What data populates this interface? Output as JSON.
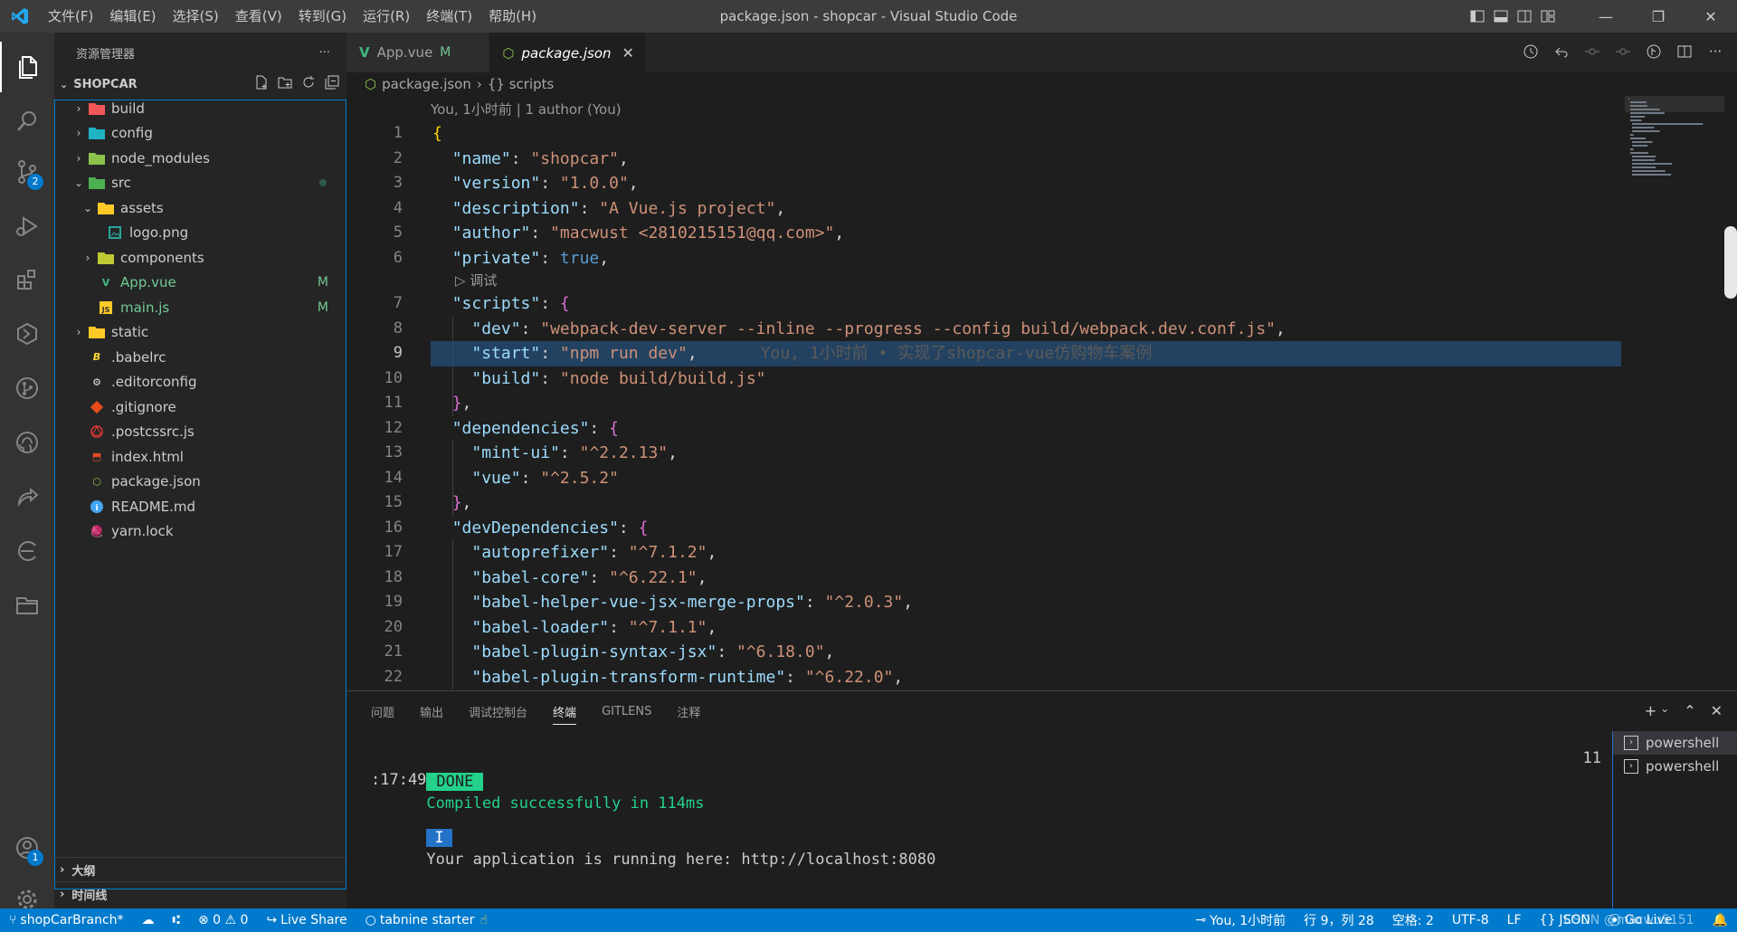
{
  "window": {
    "title": "package.json - shopcar - Visual Studio Code",
    "menu": [
      "文件(F)",
      "编辑(E)",
      "选择(S)",
      "查看(V)",
      "转到(G)",
      "运行(R)",
      "终端(T)",
      "帮助(H)"
    ]
  },
  "activity": {
    "scm_badge": "2",
    "accounts_badge": "1"
  },
  "sidebar": {
    "title": "资源管理器",
    "more": "···",
    "section": "SHOPCAR",
    "tree": [
      {
        "label": "build",
        "depth": 0,
        "chev": "›",
        "icon": "folder-build-icon",
        "color": "#f25757"
      },
      {
        "label": "config",
        "depth": 0,
        "chev": "›",
        "icon": "folder-config-icon",
        "color": "#20b3c4"
      },
      {
        "label": "node_modules",
        "depth": 0,
        "chev": "›",
        "icon": "folder-node-icon",
        "color": "#8bc34a"
      },
      {
        "label": "src",
        "depth": 0,
        "chev": "⌄",
        "icon": "folder-src-icon",
        "color": "#4caf50"
      },
      {
        "label": "assets",
        "depth": 1,
        "chev": "⌄",
        "icon": "folder-assets-icon",
        "color": "#ffca28"
      },
      {
        "label": "logo.png",
        "depth": 2,
        "chev": "",
        "icon": "image-file-icon",
        "color": "#26a69a"
      },
      {
        "label": "components",
        "depth": 1,
        "chev": "›",
        "icon": "folder-components-icon",
        "color": "#c0ca33"
      },
      {
        "label": "App.vue",
        "depth": 1,
        "chev": "",
        "icon": "vue-file-icon",
        "color": "#41b883",
        "git": "M"
      },
      {
        "label": "main.js",
        "depth": 1,
        "chev": "",
        "icon": "js-file-icon",
        "color": "#ffca28",
        "git": "M"
      },
      {
        "label": "static",
        "depth": 0,
        "chev": "›",
        "icon": "folder-static-icon",
        "color": "#ffca28"
      },
      {
        "label": ".babelrc",
        "depth": 0,
        "chev": "",
        "icon": "babel-file-icon",
        "color": "#fdd835"
      },
      {
        "label": ".editorconfig",
        "depth": 0,
        "chev": "",
        "icon": "editorconfig-file-icon",
        "color": "#e0e0e0"
      },
      {
        "label": ".gitignore",
        "depth": 0,
        "chev": "",
        "icon": "git-file-icon",
        "color": "#e64a19"
      },
      {
        "label": ".postcssrc.js",
        "depth": 0,
        "chev": "",
        "icon": "postcss-file-icon",
        "color": "#e53935"
      },
      {
        "label": "index.html",
        "depth": 0,
        "chev": "",
        "icon": "html-file-icon",
        "color": "#e44d26"
      },
      {
        "label": "package.json",
        "depth": 0,
        "chev": "",
        "icon": "nodejs-file-icon",
        "color": "#8bc34a"
      },
      {
        "label": "README.md",
        "depth": 0,
        "chev": "",
        "icon": "info-file-icon",
        "color": "#42a5f5"
      },
      {
        "label": "yarn.lock",
        "depth": 0,
        "chev": "",
        "icon": "yarn-file-icon",
        "color": "#2c8ebb"
      }
    ],
    "outline": "大纲",
    "timeline": "时间线"
  },
  "editor": {
    "tabs": [
      {
        "label": "App.vue",
        "badge": "M",
        "active": false
      },
      {
        "label": "package.json",
        "badge": "",
        "active": true
      }
    ],
    "breadcrumb": [
      "package.json",
      "{} scripts"
    ],
    "blame_header": "You, 1小时前 | 1 author (You)",
    "codelens": "▷ 调试",
    "inline_blame": "You, 1小时前 • 实现了shopcar-vue仿购物车案例",
    "lines": [
      {
        "n": "1",
        "t": "{"
      },
      {
        "n": "2",
        "t": "  \"name\": \"shopcar\","
      },
      {
        "n": "3",
        "t": "  \"version\": \"1.0.0\","
      },
      {
        "n": "4",
        "t": "  \"description\": \"A Vue.js project\","
      },
      {
        "n": "5",
        "t": "  \"author\": \"macwust <2810215151@qq.com>\","
      },
      {
        "n": "6",
        "t": "  \"private\": true,"
      },
      {
        "n": "7",
        "t": "  \"scripts\": {"
      },
      {
        "n": "8",
        "t": "    \"dev\": \"webpack-dev-server --inline --progress --config build/webpack.dev.conf.js\","
      },
      {
        "n": "9",
        "t": "    \"start\": \"npm run dev\","
      },
      {
        "n": "10",
        "t": "    \"build\": \"node build/build.js\""
      },
      {
        "n": "11",
        "t": "  },"
      },
      {
        "n": "12",
        "t": "  \"dependencies\": {"
      },
      {
        "n": "13",
        "t": "    \"mint-ui\": \"^2.2.13\","
      },
      {
        "n": "14",
        "t": "    \"vue\": \"^2.5.2\""
      },
      {
        "n": "15",
        "t": "  },"
      },
      {
        "n": "16",
        "t": "  \"devDependencies\": {"
      },
      {
        "n": "17",
        "t": "    \"autoprefixer\": \"^7.1.2\","
      },
      {
        "n": "18",
        "t": "    \"babel-core\": \"^6.22.1\","
      },
      {
        "n": "19",
        "t": "    \"babel-helper-vue-jsx-merge-props\": \"^2.0.3\","
      },
      {
        "n": "20",
        "t": "    \"babel-loader\": \"^7.1.1\","
      },
      {
        "n": "21",
        "t": "    \"babel-plugin-syntax-jsx\": \"^6.18.0\","
      },
      {
        "n": "22",
        "t": "    \"babel-plugin-transform-runtime\": \"^6.22.0\","
      }
    ]
  },
  "panel": {
    "tabs": [
      "问题",
      "输出",
      "调试控制台",
      "终端",
      "GITLENS",
      "注释"
    ],
    "active_tab": "终端",
    "terminal": {
      "done_label": "DONE",
      "compiled": "Compiled successfully in 114ms",
      "count": "11",
      "time": ":17:49",
      "info_label": "I",
      "running": "Your application is running here: http://localhost:8080"
    },
    "terminals": [
      "powershell",
      "powershell"
    ]
  },
  "statusbar": {
    "branch": "shopCarBranch*",
    "errors": "0",
    "warnings": "0",
    "liveshare": "Live Share",
    "tabnine": "tabnine starter",
    "blame": "You, 1小时前",
    "position": "行 9，列 28",
    "spaces": "空格: 2",
    "encoding": "UTF-8",
    "eol": "LF",
    "language": "JSON",
    "golive": "Go Live",
    "watermark": "CSDN @macwu5151"
  },
  "colors": {
    "accent": "#007acc",
    "statusbar": "#007acc",
    "git_modified": "#73c991",
    "terminal_done": "#23d18b"
  }
}
